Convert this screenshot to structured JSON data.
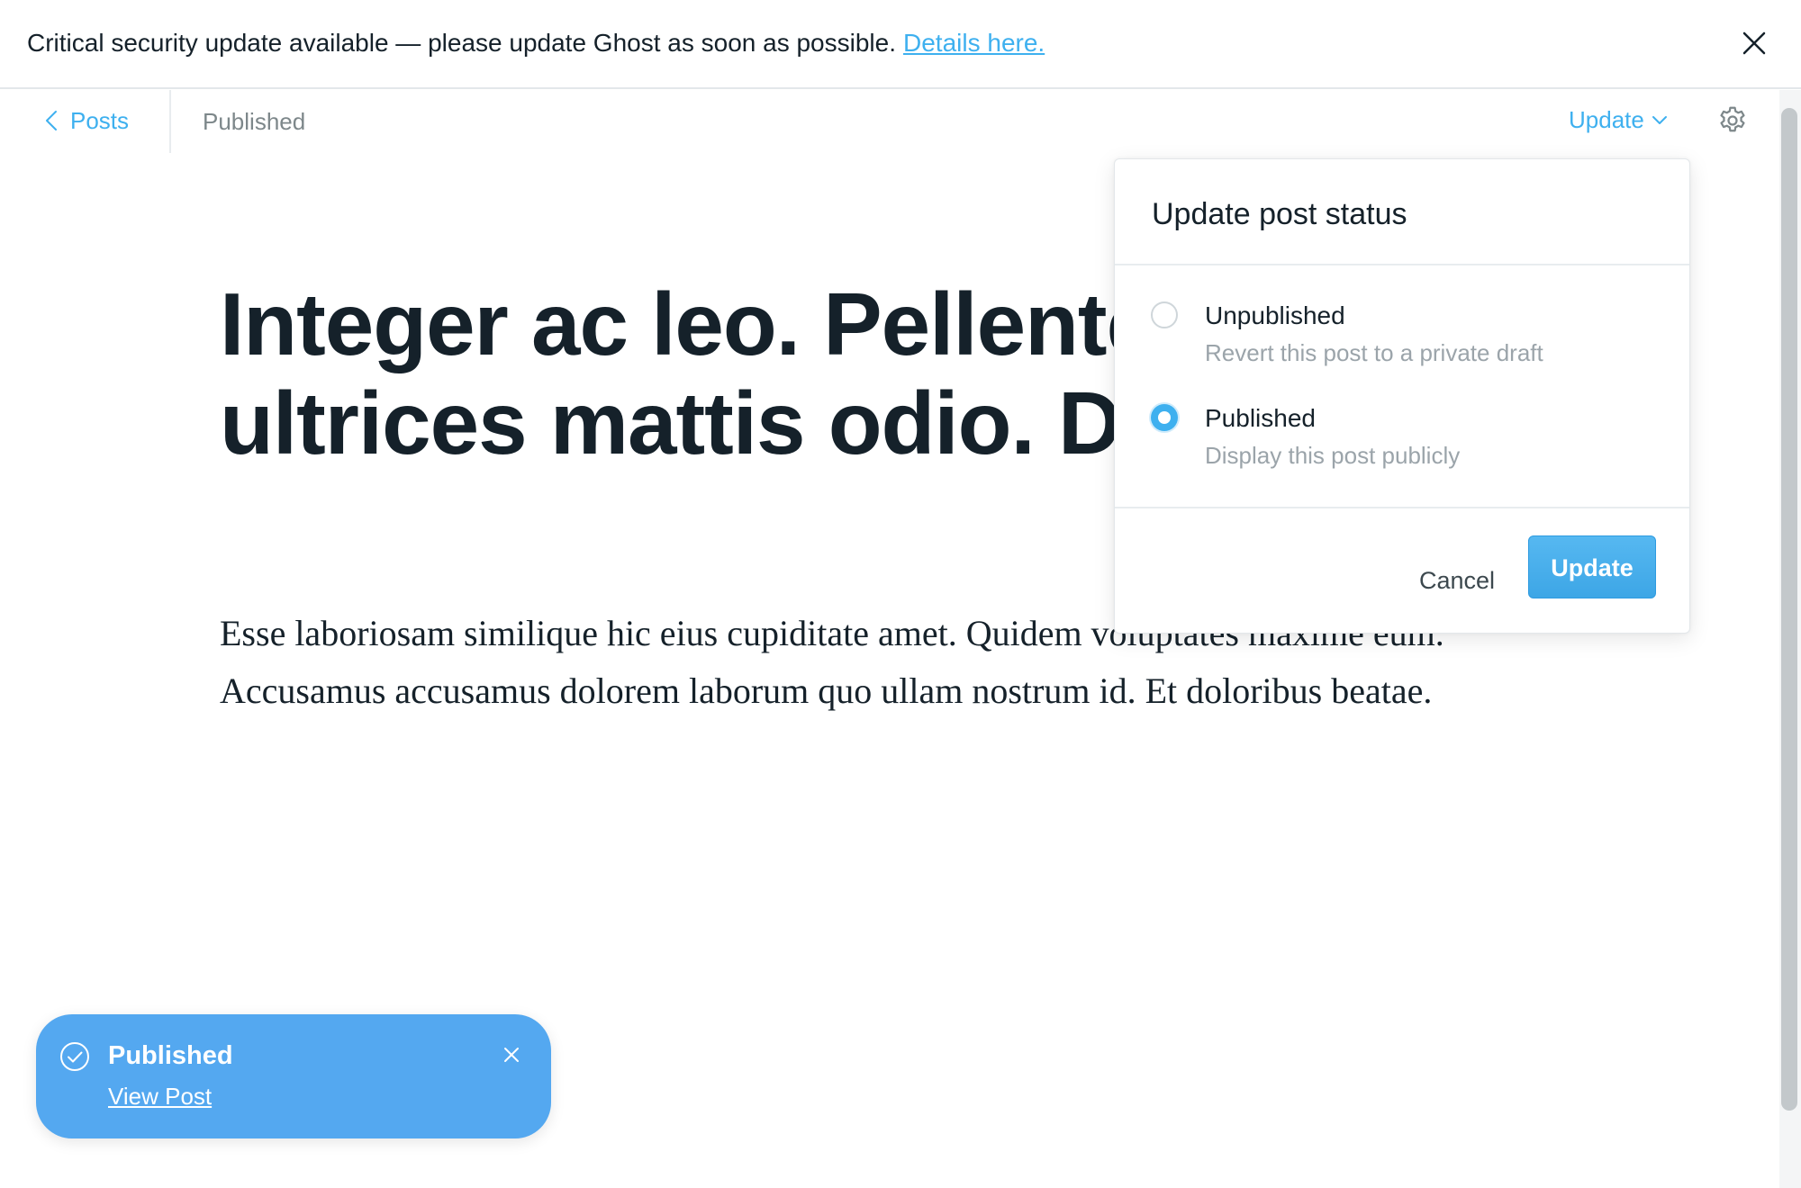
{
  "banner": {
    "message": "Critical security update available — please update Ghost as soon as possible.",
    "link_label": "Details here."
  },
  "topbar": {
    "back_label": "Posts",
    "status": "Published",
    "update_label": "Update"
  },
  "editor": {
    "title": "Integer ac leo. Pellentesque ultrices mattis odio. Donec nisi.",
    "body": "Esse laboriosam similique hic eius cupiditate amet. Quidem voluptates maxime eum. Accusamus accusamus dolorem laborum quo ullam nostrum id. Et doloribus beatae."
  },
  "dropdown": {
    "title": "Update post status",
    "options": [
      {
        "label": "Unpublished",
        "description": "Revert this post to a private draft",
        "selected": false
      },
      {
        "label": "Published",
        "description": "Display this post publicly",
        "selected": true
      }
    ],
    "cancel_label": "Cancel",
    "update_label": "Update"
  },
  "toast": {
    "title": "Published",
    "link_label": "View Post"
  },
  "colors": {
    "accent": "#3eb0ef",
    "toast_bg": "#54a8f0",
    "text": "#15212a",
    "muted": "#9ba4aa"
  }
}
